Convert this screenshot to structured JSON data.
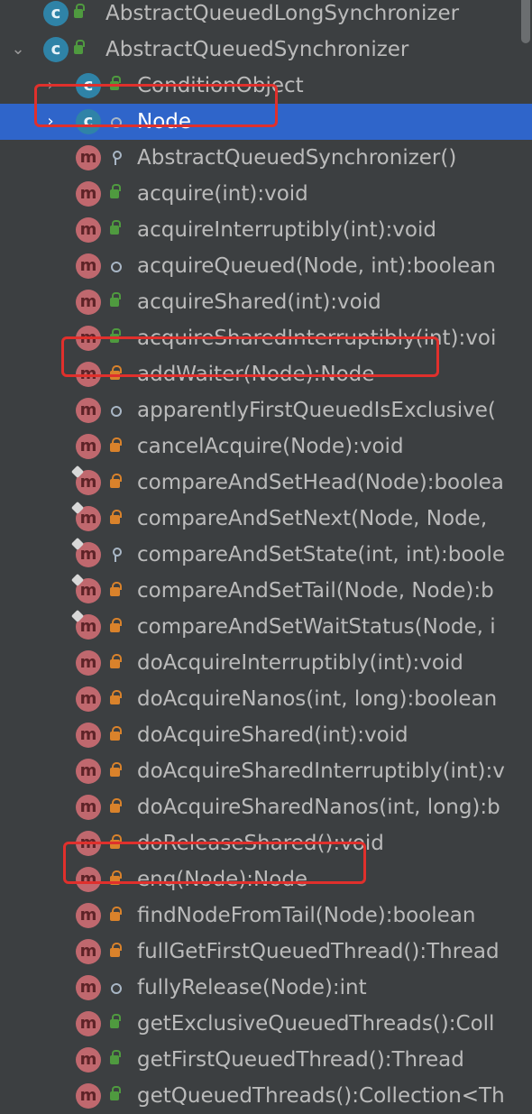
{
  "structure_tree": {
    "items": [
      {
        "label": "AbstractQueuedLongSynchronizer",
        "depth": 0,
        "arrow": "",
        "icon": "class-icon",
        "icon_letter": "c",
        "visibility": "public",
        "kind": "class"
      },
      {
        "label": "AbstractQueuedSynchronizer",
        "depth": 0,
        "arrow": "⌄",
        "icon": "class-icon",
        "icon_letter": "c",
        "visibility": "public",
        "kind": "class"
      },
      {
        "label": "ConditionObject",
        "depth": 1,
        "arrow": "›",
        "icon": "class-icon",
        "icon_letter": "c",
        "visibility": "public",
        "kind": "class"
      },
      {
        "label": "Node",
        "depth": 1,
        "arrow": "›",
        "icon": "class-icon",
        "icon_letter": "c",
        "visibility": "package",
        "kind": "class",
        "selected": true
      },
      {
        "label": "AbstractQueuedSynchronizer()",
        "depth": 2,
        "icon": "method-icon",
        "icon_letter": "m",
        "visibility": "protected"
      },
      {
        "label": "acquire(int):void",
        "depth": 2,
        "icon": "method-icon",
        "icon_letter": "m",
        "visibility": "public"
      },
      {
        "label": "acquireInterruptibly(int):void",
        "depth": 2,
        "icon": "method-icon",
        "icon_letter": "m",
        "visibility": "public"
      },
      {
        "label": "acquireQueued(Node, int):boolean",
        "depth": 2,
        "icon": "method-icon",
        "icon_letter": "m",
        "visibility": "package"
      },
      {
        "label": "acquireShared(int):void",
        "depth": 2,
        "icon": "method-icon",
        "icon_letter": "m",
        "visibility": "public"
      },
      {
        "label": "acquireSharedInterruptibly(int):voi",
        "depth": 2,
        "icon": "method-icon",
        "icon_letter": "m",
        "visibility": "public"
      },
      {
        "label": "addWaiter(Node):Node",
        "depth": 2,
        "icon": "method-icon",
        "icon_letter": "m",
        "visibility": "private"
      },
      {
        "label": "apparentlyFirstQueuedIsExclusive(",
        "depth": 2,
        "icon": "method-icon",
        "icon_letter": "m",
        "visibility": "package"
      },
      {
        "label": "cancelAcquire(Node):void",
        "depth": 2,
        "icon": "method-icon",
        "icon_letter": "m",
        "visibility": "private"
      },
      {
        "label": "compareAndSetHead(Node):boolea",
        "depth": 2,
        "icon": "method-icon",
        "icon_letter": "m",
        "visibility": "private",
        "pinned": true
      },
      {
        "label": "compareAndSetNext(Node, Node,",
        "depth": 2,
        "icon": "method-icon",
        "icon_letter": "m",
        "visibility": "private",
        "pinned": true
      },
      {
        "label": "compareAndSetState(int, int):boole",
        "depth": 2,
        "icon": "method-icon",
        "icon_letter": "m",
        "visibility": "protected",
        "pinned": true
      },
      {
        "label": "compareAndSetTail(Node, Node):b",
        "depth": 2,
        "icon": "method-icon",
        "icon_letter": "m",
        "visibility": "private",
        "pinned": true
      },
      {
        "label": "compareAndSetWaitStatus(Node, i",
        "depth": 2,
        "icon": "method-icon",
        "icon_letter": "m",
        "visibility": "private",
        "pinned": true
      },
      {
        "label": "doAcquireInterruptibly(int):void",
        "depth": 2,
        "icon": "method-icon",
        "icon_letter": "m",
        "visibility": "private"
      },
      {
        "label": "doAcquireNanos(int, long):boolean",
        "depth": 2,
        "icon": "method-icon",
        "icon_letter": "m",
        "visibility": "private"
      },
      {
        "label": "doAcquireShared(int):void",
        "depth": 2,
        "icon": "method-icon",
        "icon_letter": "m",
        "visibility": "private"
      },
      {
        "label": "doAcquireSharedInterruptibly(int):v",
        "depth": 2,
        "icon": "method-icon",
        "icon_letter": "m",
        "visibility": "private"
      },
      {
        "label": "doAcquireSharedNanos(int, long):b",
        "depth": 2,
        "icon": "method-icon",
        "icon_letter": "m",
        "visibility": "private"
      },
      {
        "label": "doReleaseShared():void",
        "depth": 2,
        "icon": "method-icon",
        "icon_letter": "m",
        "visibility": "private"
      },
      {
        "label": "enq(Node):Node",
        "depth": 2,
        "icon": "method-icon",
        "icon_letter": "m",
        "visibility": "private"
      },
      {
        "label": "findNodeFromTail(Node):boolean",
        "depth": 2,
        "icon": "method-icon",
        "icon_letter": "m",
        "visibility": "private"
      },
      {
        "label": "fullGetFirstQueuedThread():Thread",
        "depth": 2,
        "icon": "method-icon",
        "icon_letter": "m",
        "visibility": "private"
      },
      {
        "label": "fullyRelease(Node):int",
        "depth": 2,
        "icon": "method-icon",
        "icon_letter": "m",
        "visibility": "package"
      },
      {
        "label": "getExclusiveQueuedThreads():Coll",
        "depth": 2,
        "icon": "method-icon",
        "icon_letter": "m",
        "visibility": "public"
      },
      {
        "label": "getFirstQueuedThread():Thread",
        "depth": 2,
        "icon": "method-icon",
        "icon_letter": "m",
        "visibility": "public"
      },
      {
        "label": "getQueuedThreads():Collection<Th",
        "depth": 2,
        "icon": "method-icon",
        "icon_letter": "m",
        "visibility": "public"
      }
    ]
  },
  "colors": {
    "background": "#3c3f41",
    "selection": "#2f65ca",
    "highlight_box": "#e0302c",
    "method_icon": "#c0686e",
    "class_icon": "#2f83a7"
  }
}
